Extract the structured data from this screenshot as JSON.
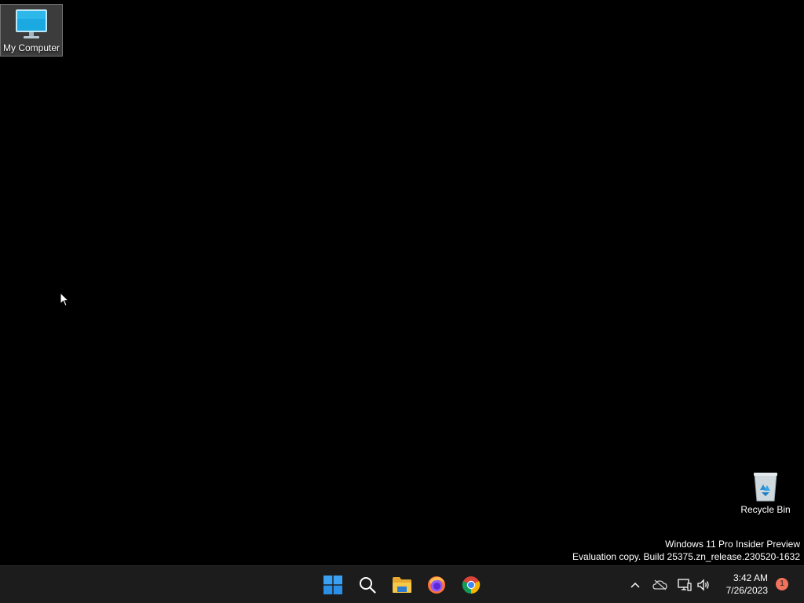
{
  "desktop": {
    "background_color": "#000000",
    "icons": [
      {
        "label": "My Computer",
        "icon": "monitor-icon",
        "selected": true
      },
      {
        "label": "Recycle Bin",
        "icon": "recycle-bin-icon",
        "selected": false
      }
    ],
    "watermark": {
      "line1": "Windows 11 Pro Insider Preview",
      "line2": "Evaluation copy. Build 25375.zn_release.230520-1632"
    }
  },
  "taskbar": {
    "background_color": "#1c1c1c",
    "pinned": [
      {
        "name": "Start",
        "icon": "windows-start-icon"
      },
      {
        "name": "Search",
        "icon": "search-icon"
      },
      {
        "name": "File Explorer",
        "icon": "folder-icon"
      },
      {
        "name": "Firefox",
        "icon": "firefox-icon"
      },
      {
        "name": "Chrome",
        "icon": "chrome-icon"
      }
    ],
    "tray": {
      "icons": [
        "chevron-up-icon",
        "onedrive-offline-icon",
        "network-icon",
        "volume-icon"
      ],
      "time": "3:42 AM",
      "date": "7/26/2023",
      "notification_count": "1",
      "notification_color": "#f2735b"
    }
  }
}
